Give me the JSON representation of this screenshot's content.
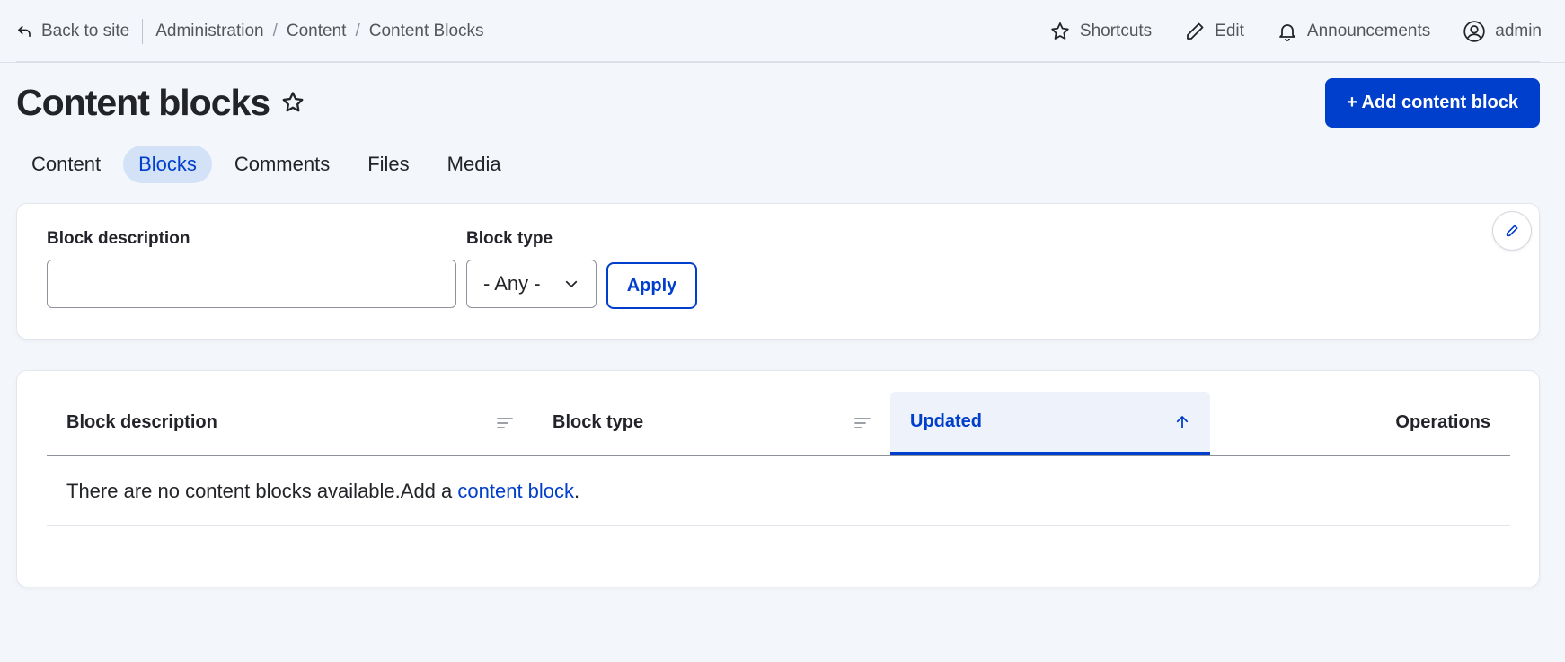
{
  "toolbar": {
    "back_label": "Back to site",
    "breadcrumb": [
      "Administration",
      "Content",
      "Content Blocks"
    ],
    "breadcrumb_separator": "/",
    "shortcuts_label": "Shortcuts",
    "edit_label": "Edit",
    "announcements_label": "Announcements",
    "user_label": "admin"
  },
  "header": {
    "title": "Content blocks",
    "add_button_label": "+ Add content block"
  },
  "tabs": [
    {
      "label": "Content",
      "active": false
    },
    {
      "label": "Blocks",
      "active": true
    },
    {
      "label": "Comments",
      "active": false
    },
    {
      "label": "Files",
      "active": false
    },
    {
      "label": "Media",
      "active": false
    }
  ],
  "filters": {
    "description_label": "Block description",
    "description_value": "",
    "type_label": "Block type",
    "type_selected": "- Any -",
    "apply_label": "Apply"
  },
  "table": {
    "columns": [
      "Block description",
      "Block type",
      "Updated",
      "Operations"
    ],
    "empty_text": "There are no content blocks available.Add a ",
    "empty_link": "content block",
    "empty_suffix": "."
  },
  "colors": {
    "accent": "#003ecc",
    "active_tab_bg": "#d4e2f8",
    "page_bg": "#f3f6fb"
  }
}
